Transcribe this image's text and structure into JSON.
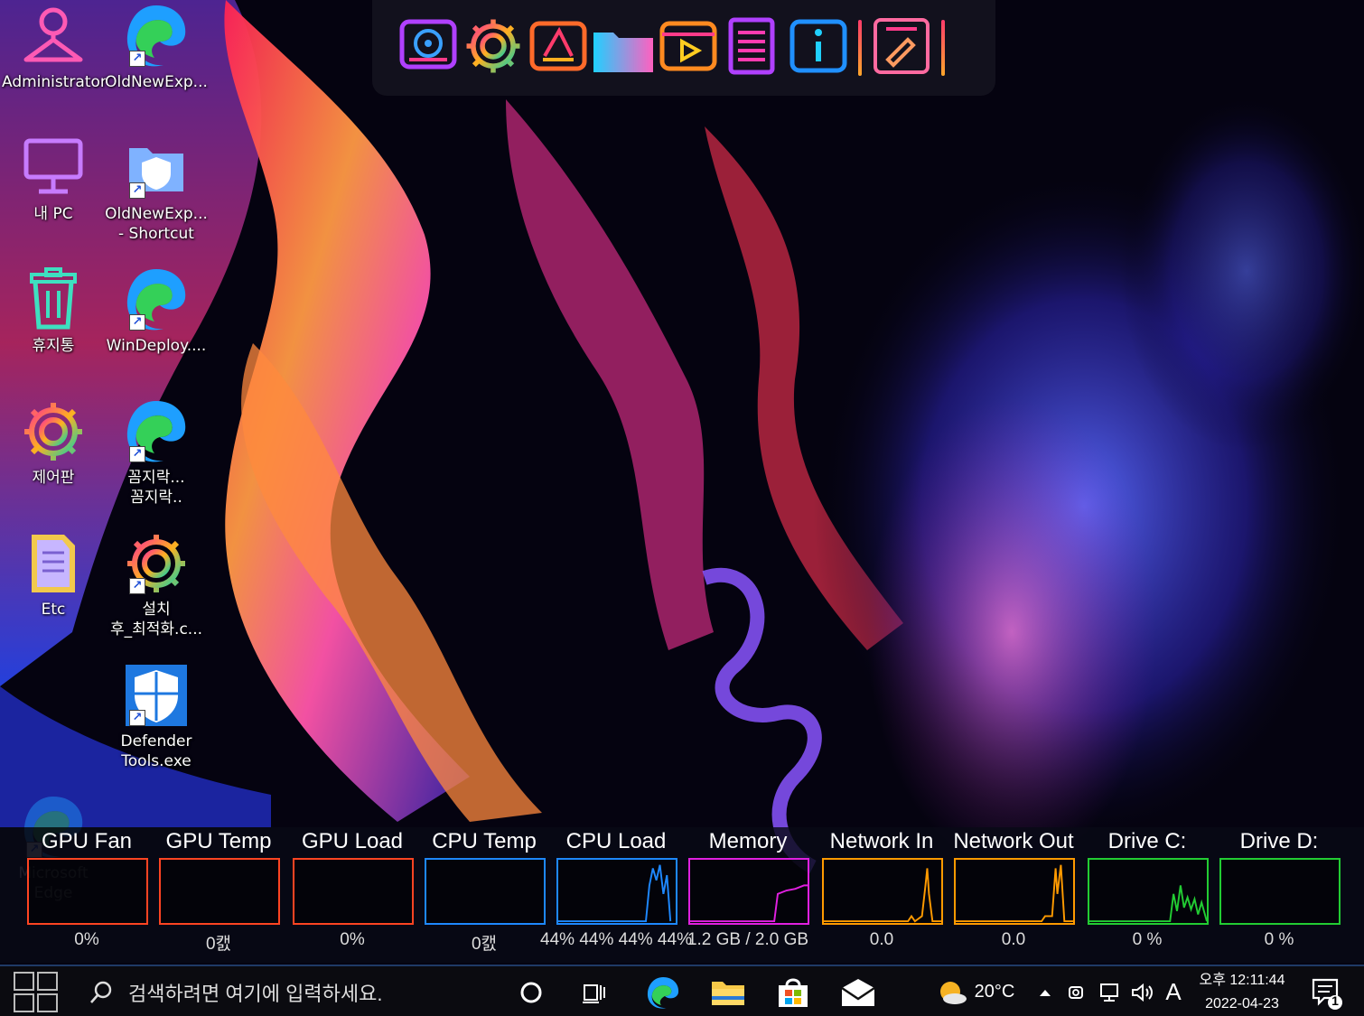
{
  "desktop": {
    "icons": [
      {
        "label": "Administrator",
        "icon": "user-icon"
      },
      {
        "label": "OldNewExp...",
        "icon": "edge-icon",
        "shortcut": true
      },
      {
        "label": "내 PC",
        "icon": "monitor-icon"
      },
      {
        "label": "OldNewExp...\n- Shortcut",
        "icon": "shield-folder-icon",
        "shortcut": true
      },
      {
        "label": "휴지통",
        "icon": "recycle-bin-icon"
      },
      {
        "label": "WinDeploy....",
        "icon": "edge-icon",
        "shortcut": true
      },
      {
        "label": "제어판",
        "icon": "gear-icon"
      },
      {
        "label": "꼼지락...\n꼼지락..",
        "icon": "edge-icon",
        "shortcut": true
      },
      {
        "label": "Etc",
        "icon": "folder-icon"
      },
      {
        "label": "설치\n후_최적화.c...",
        "icon": "gear-icon",
        "shortcut": true
      },
      {
        "label": "Defender\nTools.exe",
        "icon": "windows-shield-icon",
        "shortcut": true
      },
      {
        "label": "Microsoft\nEdge",
        "icon": "edge-icon",
        "shortcut": true
      }
    ]
  },
  "dock": {
    "items": [
      "disk-icon",
      "gear-icon",
      "drive-icon",
      "folder-icon",
      "media-player-icon",
      "document-icon",
      "info-icon",
      "cleaner-icon"
    ]
  },
  "monitor": {
    "gauges": [
      {
        "title": "GPU Fan",
        "value": "0%",
        "color": "#ff4422"
      },
      {
        "title": "GPU Temp",
        "value": "0캜",
        "color": "#ff4422"
      },
      {
        "title": "GPU Load",
        "value": "0%",
        "color": "#ff4422"
      },
      {
        "title": "CPU Temp",
        "value": "0캜",
        "color": "#1e88ff"
      },
      {
        "title": "CPU Load",
        "value": "44%  44%  44%  44%",
        "color": "#1e88ff"
      },
      {
        "title": "Memory",
        "value": "1.2 GB / 2.0 GB",
        "color": "#e020e0"
      },
      {
        "title": "Network In",
        "value": "0.0",
        "color": "#ff9a00"
      },
      {
        "title": "Network Out",
        "value": "0.0",
        "color": "#ff9a00"
      },
      {
        "title": "Drive C:",
        "value": "0 %",
        "color": "#22cc33"
      },
      {
        "title": "Drive D:",
        "value": "0 %",
        "color": "#22cc33"
      }
    ]
  },
  "taskbar": {
    "search_placeholder": "검색하려면 여기에 입력하세요.",
    "pinned": [
      "cortana-icon",
      "task-view-icon",
      "edge-icon",
      "file-explorer-icon",
      "store-icon",
      "mail-icon"
    ],
    "weather": "20°C",
    "input_indicator": "A",
    "time": "오후 12:11:44",
    "date": "2022-04-23",
    "notification_count": "1"
  },
  "colors": {
    "taskbar_bg": "#0b0b10",
    "accent_blue": "#1e88ff",
    "accent_orange": "#ff9a00"
  }
}
